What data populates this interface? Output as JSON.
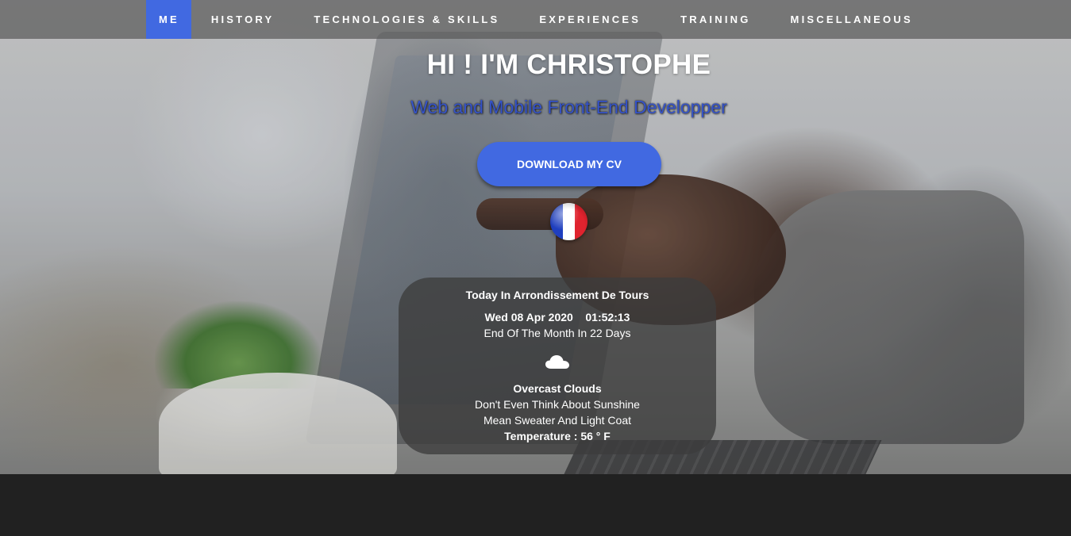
{
  "nav": {
    "items": [
      {
        "label": "ME",
        "active": true
      },
      {
        "label": "HISTORY",
        "active": false
      },
      {
        "label": "TECHNOLOGIES & SKILLS",
        "active": false
      },
      {
        "label": "EXPERIENCES",
        "active": false
      },
      {
        "label": "TRAINING",
        "active": false
      },
      {
        "label": "MISCELLANEOUS",
        "active": false
      }
    ],
    "active_color": "#4169e1"
  },
  "hero": {
    "title": "HI ! I'M CHRISTOPHE",
    "subtitle": "Web and Mobile Front-End Developper",
    "cv_button": "DOWNLOAD MY CV",
    "language_flag": "french-flag-icon"
  },
  "weather": {
    "location_line": "Today In Arrondissement De Tours",
    "date": "Wed 08 Apr 2020",
    "time": "01:52:13",
    "month_end": "End Of The Month In 22 Days",
    "icon": "cloud-icon",
    "condition": "Overcast Clouds",
    "advice_1": "Don't Even Think About Sunshine",
    "advice_2": "Mean Sweater And Light Coat",
    "temperature": "Temperature : 56 ° F"
  },
  "colors": {
    "accent": "#4169e1",
    "subtitle": "#3553c8",
    "footer": "#212121"
  }
}
